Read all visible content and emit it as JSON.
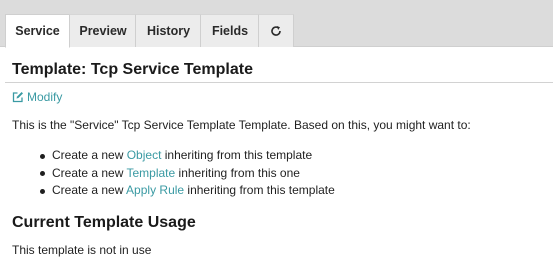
{
  "tabs": [
    {
      "label": "Service",
      "active": true
    },
    {
      "label": "Preview",
      "active": false
    },
    {
      "label": "History",
      "active": false
    },
    {
      "label": "Fields",
      "active": false
    }
  ],
  "refresh_icon": "refresh-icon",
  "header": {
    "title": "Template: Tcp Service Template"
  },
  "actions": {
    "modify_label": "Modify",
    "modify_icon": "edit-icon"
  },
  "intro_text": "This is the \"Service\" Tcp Service Template Template. Based on this, you might want to:",
  "suggestions": [
    {
      "prefix": "Create a new ",
      "link": "Object",
      "suffix": " inheriting from this template"
    },
    {
      "prefix": "Create a new ",
      "link": "Template",
      "suffix": " inheriting from this one"
    },
    {
      "prefix": "Create a new ",
      "link": "Apply Rule",
      "suffix": " inheriting from this template"
    }
  ],
  "usage": {
    "title": "Current Template Usage",
    "text": "This template is not in use"
  },
  "colors": {
    "link": "#3a9aa3",
    "tabbar_bg": "#dcdcdc",
    "text": "#1f1f1f"
  }
}
